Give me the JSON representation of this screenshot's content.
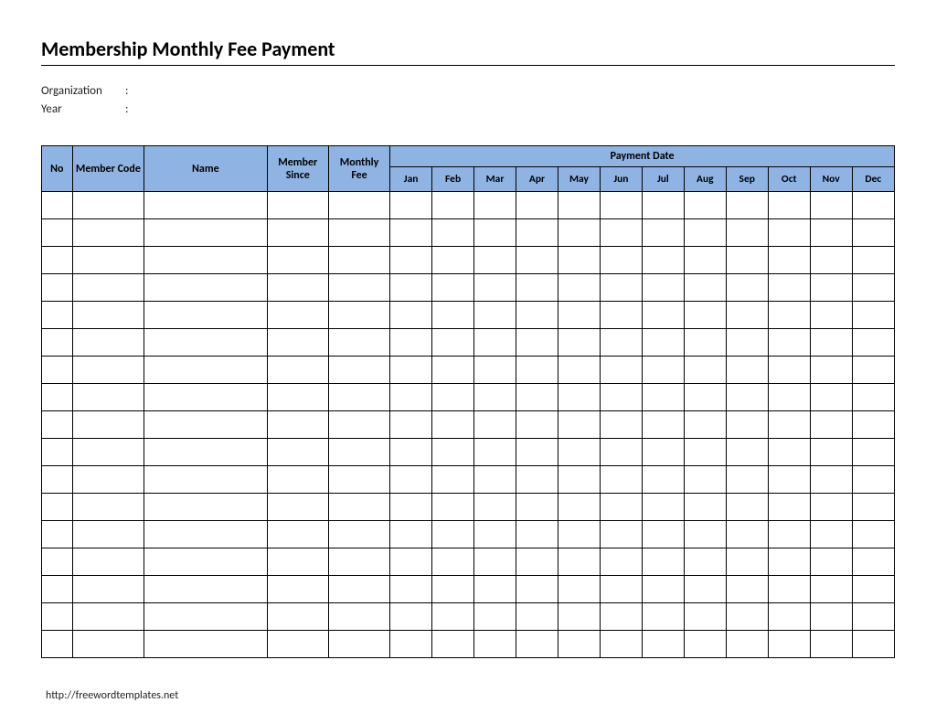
{
  "title": "Membership Monthly Fee Payment",
  "meta": {
    "organization_label": "Organization",
    "year_label": "Year",
    "colon": ":"
  },
  "table": {
    "headers": {
      "no": "No",
      "member_code": "Member Code",
      "name": "Name",
      "member_since": "Member Since",
      "monthly_fee": "Monthly Fee",
      "payment_date": "Payment Date"
    },
    "months": [
      "Jan",
      "Feb",
      "Mar",
      "Apr",
      "May",
      "Jun",
      "Jul",
      "Aug",
      "Sep",
      "Oct",
      "Nov",
      "Dec"
    ],
    "row_count": 17
  },
  "footer": {
    "link": "http://freewordtemplates.net"
  }
}
